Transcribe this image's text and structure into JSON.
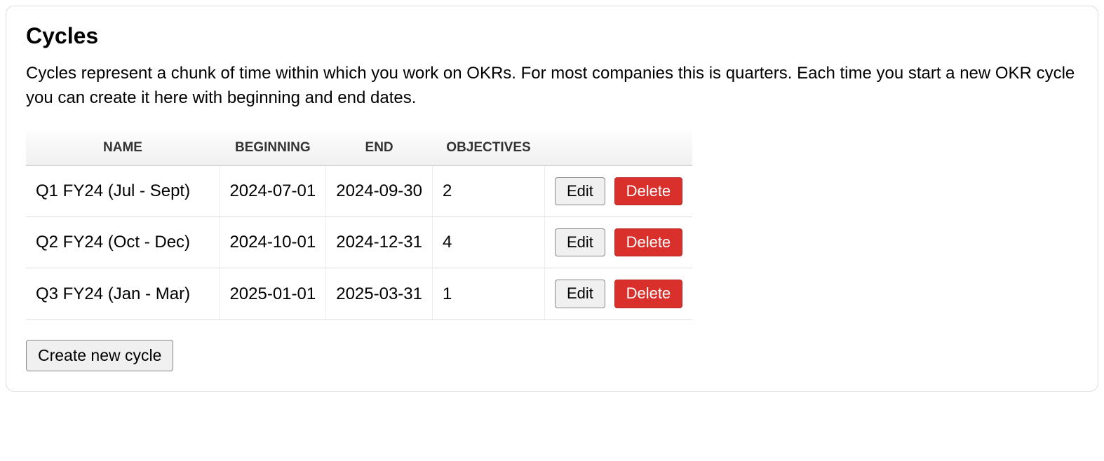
{
  "title": "Cycles",
  "description": "Cycles represent a chunk of time within which you work on OKRs. For most companies this is quarters. Each time you start a new OKR cycle you can create it here with beginning and end dates.",
  "table": {
    "headers": {
      "name": "Name",
      "beginning": "Beginning",
      "end": "End",
      "objectives": "Objectives"
    },
    "rows": [
      {
        "name": "Q1 FY24 (Jul - Sept)",
        "beginning": "2024-07-01",
        "end": "2024-09-30",
        "objectives": "2"
      },
      {
        "name": "Q2 FY24 (Oct - Dec)",
        "beginning": "2024-10-01",
        "end": "2024-12-31",
        "objectives": "4"
      },
      {
        "name": "Q3 FY24 (Jan - Mar)",
        "beginning": "2025-01-01",
        "end": "2025-03-31",
        "objectives": "1"
      }
    ]
  },
  "actions": {
    "edit_label": "Edit",
    "delete_label": "Delete",
    "create_label": "Create new cycle"
  }
}
